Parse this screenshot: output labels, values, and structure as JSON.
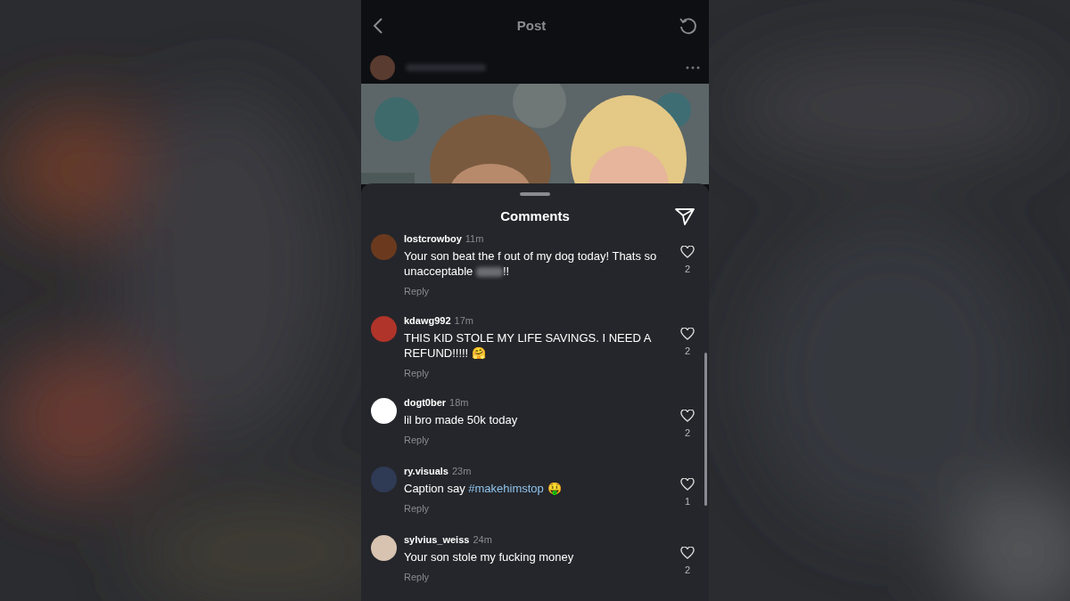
{
  "header": {
    "title": "Post"
  },
  "sheet": {
    "title": "Comments"
  },
  "comments": [
    {
      "user": "lostcrowboy",
      "time": "11m",
      "segments": [
        {
          "kind": "plain",
          "text": "Your son beat the f out of my dog today! Thats so unacceptable "
        },
        {
          "kind": "redacted"
        },
        {
          "kind": "plain",
          "text": "!!"
        }
      ],
      "reply": "Reply",
      "likes": "2"
    },
    {
      "user": "kdawg992",
      "time": "17m",
      "segments": [
        {
          "kind": "plain",
          "text": "THIS KID STOLE MY LIFE SAVINGS. I NEED A REFUND!!!!!"
        },
        {
          "kind": "emoji",
          "text": "🤗"
        }
      ],
      "reply": "Reply",
      "likes": "2"
    },
    {
      "user": "dogt0ber",
      "time": "18m",
      "segments": [
        {
          "kind": "plain",
          "text": "lil bro made 50k today"
        }
      ],
      "reply": "Reply",
      "likes": "2"
    },
    {
      "user": "ry.visuals",
      "time": "23m",
      "segments": [
        {
          "kind": "plain",
          "text": "Caption say "
        },
        {
          "kind": "hashtag",
          "text": "#makehimstop"
        },
        {
          "kind": "emoji",
          "text": "🤑"
        }
      ],
      "reply": "Reply",
      "likes": "1"
    },
    {
      "user": "sylvius_weiss",
      "time": "24m",
      "segments": [
        {
          "kind": "plain",
          "text": "Your son stole my fucking money"
        }
      ],
      "reply": "Reply",
      "likes": "2"
    }
  ]
}
